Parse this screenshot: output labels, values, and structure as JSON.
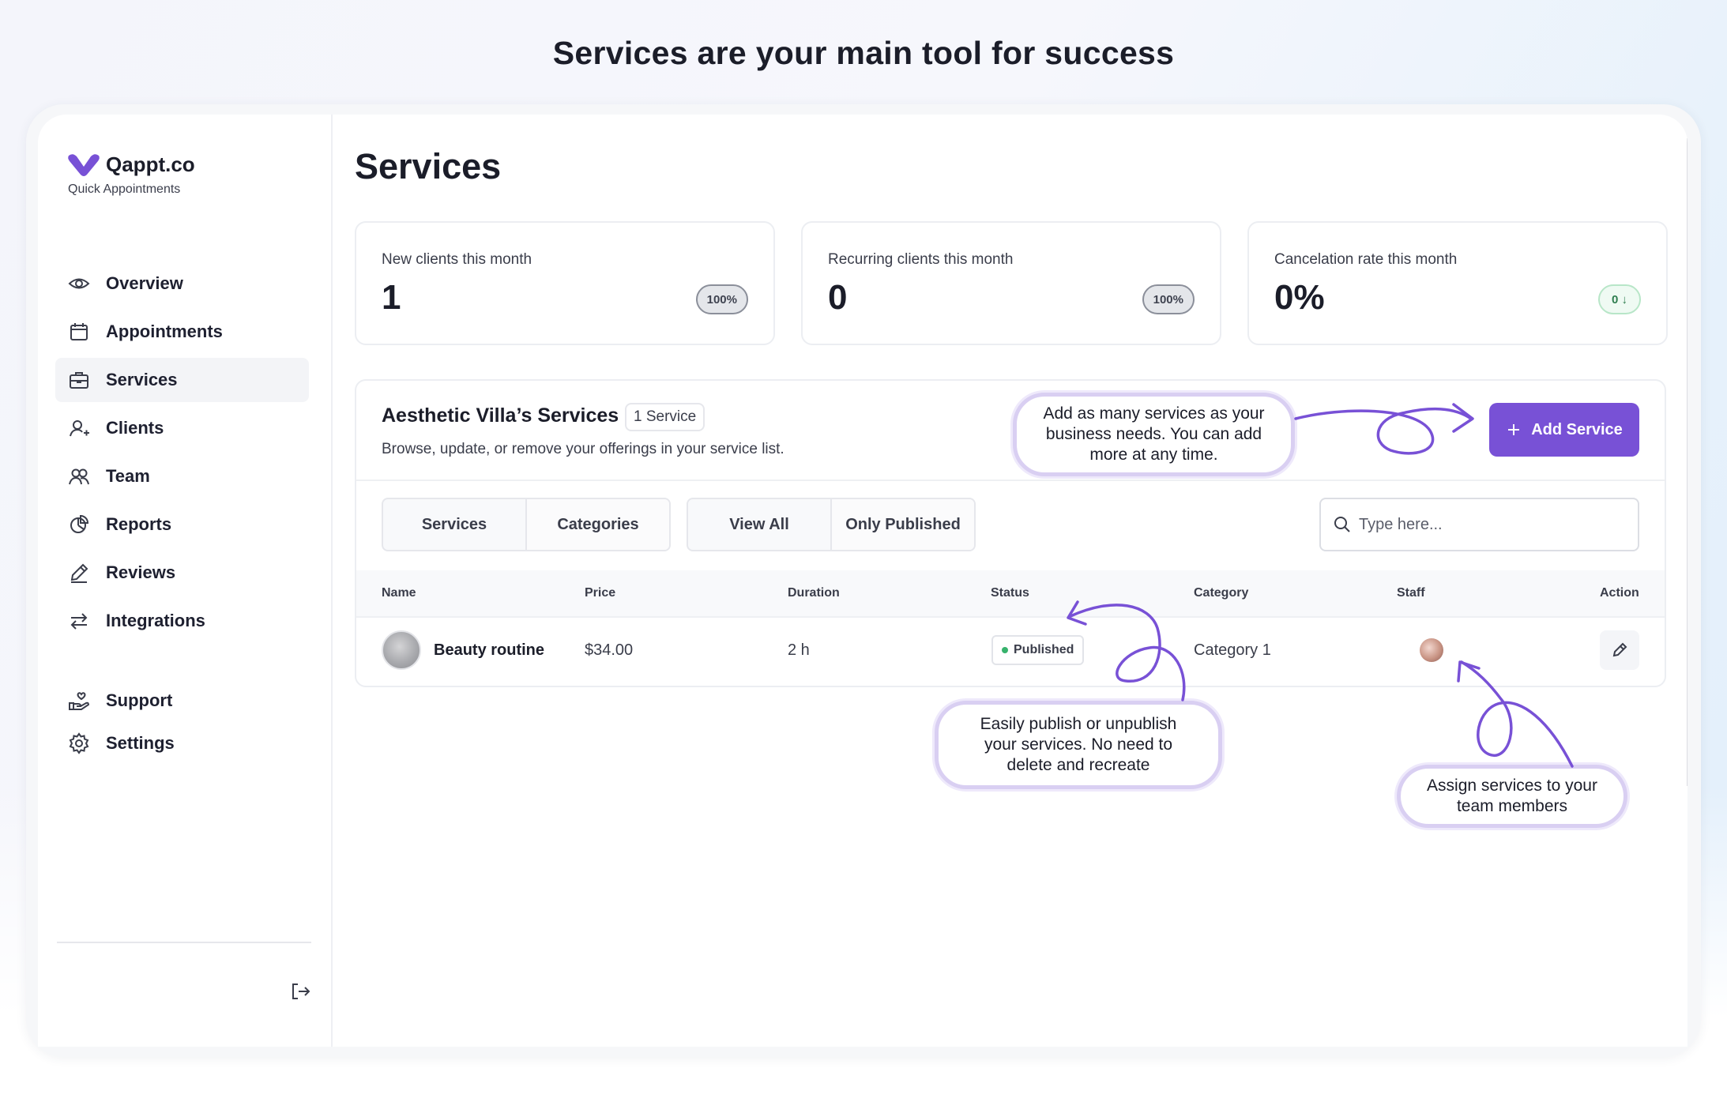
{
  "headline": "Services are your main tool for success",
  "brand": {
    "name": "Qappt.co",
    "tagline": "Quick Appointments",
    "color": "#7851d6"
  },
  "sidebar": {
    "items": [
      {
        "label": "Overview",
        "icon": "eye-icon"
      },
      {
        "label": "Appointments",
        "icon": "calendar-icon"
      },
      {
        "label": "Services",
        "icon": "briefcase-icon",
        "active": true
      },
      {
        "label": "Clients",
        "icon": "user-plus-icon"
      },
      {
        "label": "Team",
        "icon": "users-icon"
      },
      {
        "label": "Reports",
        "icon": "pie-chart-icon"
      },
      {
        "label": "Reviews",
        "icon": "pen-icon"
      },
      {
        "label": "Integrations",
        "icon": "arrows-swap-icon"
      }
    ],
    "secondary": [
      {
        "label": "Support",
        "icon": "hand-heart-icon"
      },
      {
        "label": "Settings",
        "icon": "gear-icon"
      }
    ],
    "logout_icon": "logout-icon"
  },
  "page": {
    "title": "Services"
  },
  "stats": [
    {
      "label": "New clients this month",
      "value": "1",
      "badge": "100%"
    },
    {
      "label": "Recurring clients this month",
      "value": "0",
      "badge": "100%"
    },
    {
      "label": "Cancelation rate this month",
      "value": "0%",
      "badge": "0 ↓"
    }
  ],
  "panel": {
    "title": "Aesthetic Villa’s Services",
    "count": "1 Service",
    "subtitle": "Browse, update, or remove your offerings in your service list.",
    "add_button": "Add Service",
    "view_tabs": [
      "Services",
      "Categories"
    ],
    "filter_tabs": [
      "View All",
      "Only Published"
    ],
    "search_placeholder": "Type here..."
  },
  "table": {
    "columns": [
      "Name",
      "Price",
      "Duration",
      "Status",
      "Category",
      "Staff",
      "Action"
    ],
    "rows": [
      {
        "name": "Beauty routine",
        "price": "$34.00",
        "duration": "2 h",
        "status": "Published",
        "category": "Category 1"
      }
    ]
  },
  "callouts": {
    "add": [
      "Add as many services as your",
      "business needs. You can add",
      "more at any time."
    ],
    "publish": [
      "Easily publish or unpublish",
      "your services. No need to",
      "delete and recreate"
    ],
    "assign": [
      "Assign services to your",
      "team members"
    ]
  },
  "colors": {
    "accent": "#7851d6",
    "callout_border": "#d9cff2",
    "published_dot": "#37b26c"
  }
}
